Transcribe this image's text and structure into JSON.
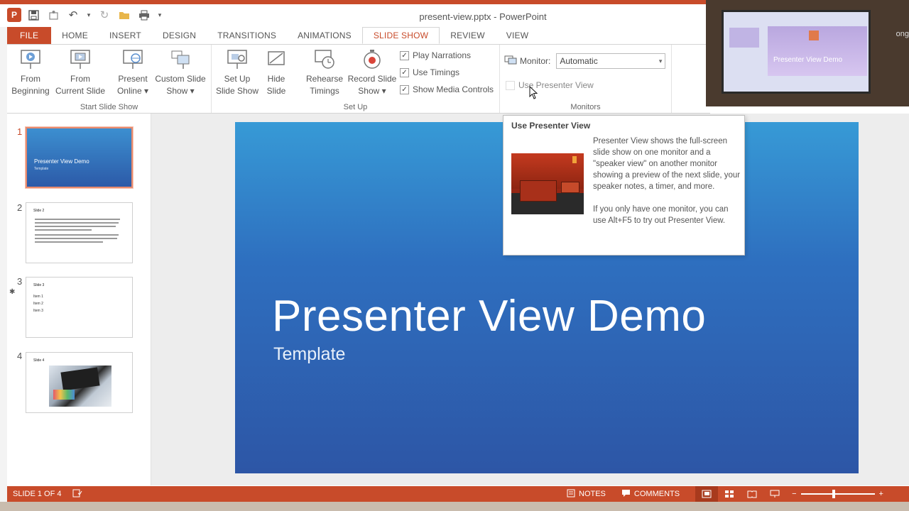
{
  "window": {
    "title": "present-view.pptx - PowerPoint",
    "edge_text": "ong"
  },
  "quick_access": {
    "icons": [
      "powerpoint-icon",
      "save-icon",
      "touch-mode-icon",
      "undo-icon",
      "redo-icon",
      "open-icon",
      "print-icon",
      "customize-icon"
    ]
  },
  "tabs": [
    "FILE",
    "HOME",
    "INSERT",
    "DESIGN",
    "TRANSITIONS",
    "ANIMATIONS",
    "SLIDE SHOW",
    "REVIEW",
    "VIEW"
  ],
  "active_tab": "SLIDE SHOW",
  "ribbon": {
    "start_group": {
      "label": "Start Slide Show",
      "from_beginning": "From\nBeginning",
      "from_current": "From\nCurrent Slide",
      "present_online": "Present\nOnline ▾",
      "custom_show": "Custom Slide\nShow ▾"
    },
    "setup_group": {
      "label": "Set Up",
      "setup_show": "Set Up\nSlide Show",
      "hide_slide": "Hide\nSlide",
      "rehearse": "Rehearse\nTimings",
      "record": "Record Slide\nShow ▾",
      "play_narrations": "Play Narrations",
      "use_timings": "Use Timings",
      "show_media_controls": "Show Media Controls"
    },
    "monitors_group": {
      "label": "Monitors",
      "monitor_label": "Monitor:",
      "monitor_value": "Automatic",
      "use_presenter_view": "Use Presenter View"
    }
  },
  "slides": [
    {
      "num": "1",
      "title": "Presenter View Demo",
      "sub": "Template"
    },
    {
      "num": "2",
      "title": "Slide 2"
    },
    {
      "num": "3",
      "title": "Slide 3",
      "items": [
        "Item 1",
        "Item 2",
        "Item 3"
      ]
    },
    {
      "num": "4",
      "title": "Slide 4"
    }
  ],
  "main_slide": {
    "title": "Presenter View Demo",
    "subtitle": "Template"
  },
  "tooltip": {
    "title": "Use Presenter View",
    "para1": "Presenter View shows the full-screen slide show on one monitor and a \"speaker view\" on another monitor showing a preview of the next slide, your speaker notes, a timer, and more.",
    "para2": "If you only have one monitor, you can use Alt+F5 to try out Presenter View."
  },
  "status": {
    "slide_info": "SLIDE 1 OF 4",
    "notes": "NOTES",
    "comments": "COMMENTS"
  },
  "colors": {
    "accent": "#c84b2a",
    "slide_top": "#379ad6",
    "slide_bottom": "#2d56a6"
  }
}
